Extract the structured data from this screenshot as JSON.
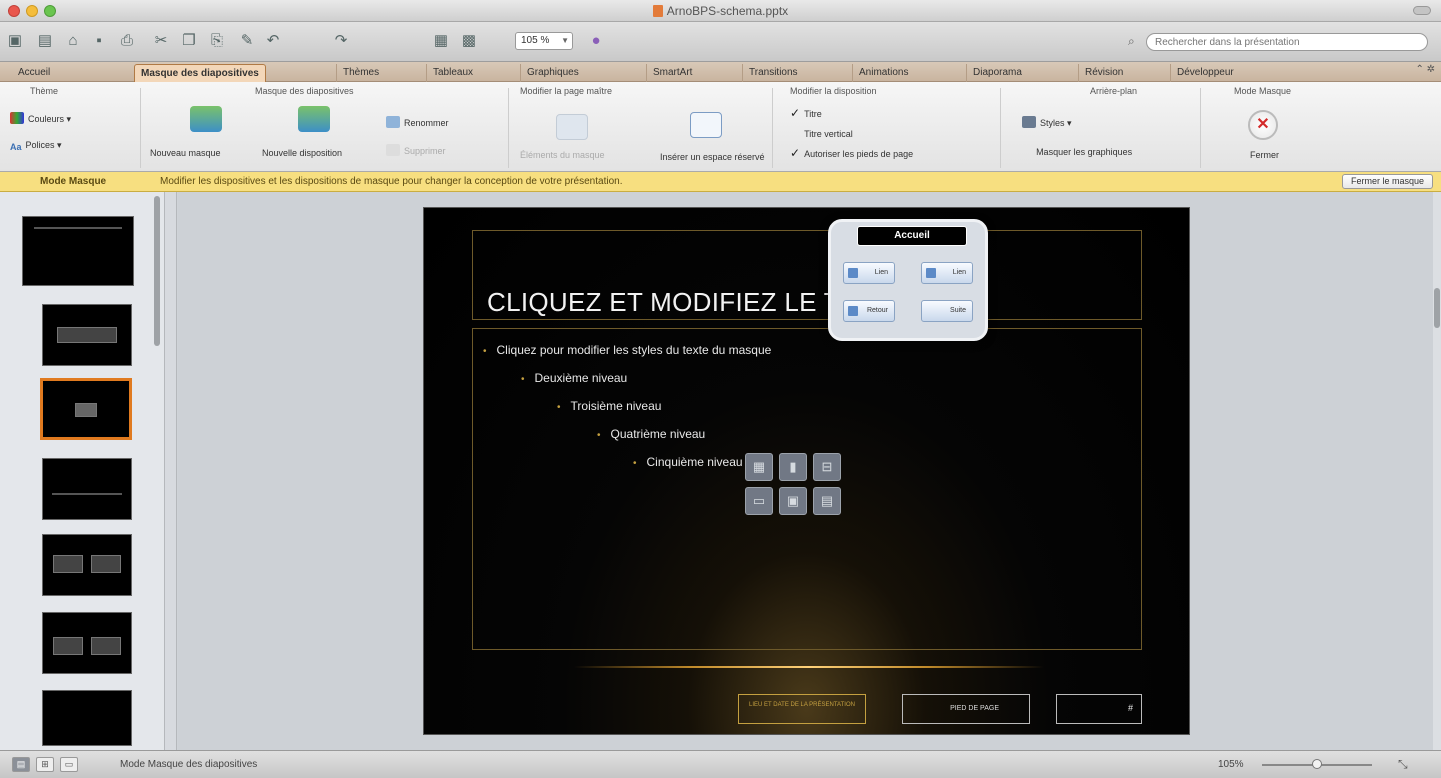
{
  "window": {
    "title": "ArnoBPS-schema.pptx"
  },
  "toolbar": {
    "zoom": "105 %",
    "search_placeholder": "Rechercher dans la présentation"
  },
  "tabs": [
    {
      "label": "Accueil"
    },
    {
      "label": "Masque des diapositives",
      "active": true
    },
    {
      "label": "Thèmes"
    },
    {
      "label": "Tableaux"
    },
    {
      "label": "Graphiques"
    },
    {
      "label": "SmartArt"
    },
    {
      "label": "Transitions"
    },
    {
      "label": "Animations"
    },
    {
      "label": "Diaporama"
    },
    {
      "label": "Révision"
    },
    {
      "label": "Développeur"
    }
  ],
  "ribbon": {
    "groups": {
      "theme": "Thème",
      "master": "Masque des diapositives",
      "master_layout": "Modifier la page maître",
      "edit_layout": "Modifier la disposition",
      "background": "Arrière-plan",
      "master_view": "Mode Masque"
    },
    "colors_label": "Couleurs",
    "fonts_label": "Polices",
    "new_master": "Nouveau masque",
    "new_layout": "Nouvelle disposition",
    "rename": "Renommer",
    "delete": "Supprimer",
    "master_elements": "Éléments du masque",
    "insert_placeholder": "Insérer un espace réservé",
    "title_check": "Titre",
    "vertical_title": "Titre vertical",
    "allow_footers": "Autoriser les pieds de page",
    "styles": "Styles",
    "hide_graphics": "Masquer les graphiques",
    "close": "Fermer"
  },
  "message_bar": {
    "label": "Mode Masque",
    "text": "Modifier les dispositives et les dispositions de masque pour changer la conception de votre présentation.",
    "button": "Fermer le masque"
  },
  "slide": {
    "title": "CLIQUEZ ET MODIFIEZ LE TITRE",
    "bullets": [
      "Cliquez pour modifier les styles du texte du masque",
      "Deuxième niveau",
      "Troisième niveau",
      "Quatrième niveau",
      "Cinquième niveau"
    ],
    "footer_left": "LIEU ET DATE DE LA PRÉSENTATION",
    "footer_mid": "PIED DE PAGE",
    "footer_num": "#"
  },
  "palette": {
    "header": "Accueil",
    "buttons": [
      "Lien",
      "Lien",
      "Retour",
      "Suite"
    ]
  },
  "status": {
    "text": "Mode Masque des diapositives",
    "zoom": "105%"
  }
}
